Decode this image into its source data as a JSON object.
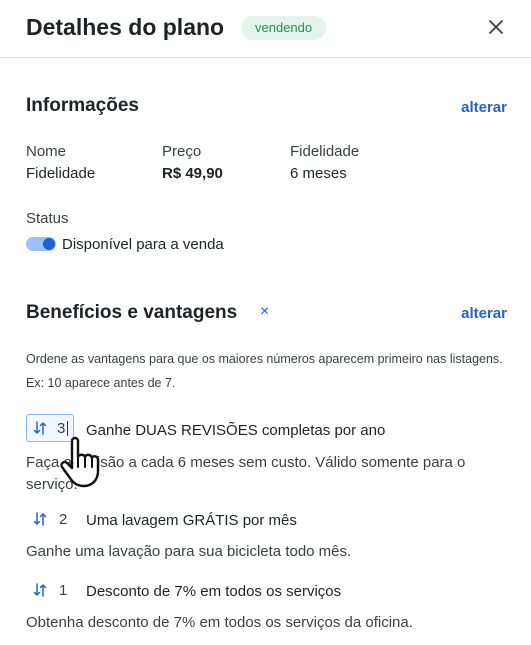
{
  "header": {
    "title": "Detalhes do plano",
    "status_badge": "vendendo"
  },
  "info": {
    "title": "Informações",
    "edit_link": "alterar",
    "fields": [
      {
        "label": "Nome",
        "value": "Fidelidade"
      },
      {
        "label": "Preço",
        "value": "R$ 49,90"
      },
      {
        "label": "Fidelidade",
        "value": "6 meses"
      }
    ],
    "status_label": "Status",
    "status_toggle_label": "Disponível para a venda",
    "status_on": true
  },
  "benefits": {
    "title": "Benefícios e vantagens",
    "close_glyph": "×",
    "edit_link": "alterar",
    "helper": "Ordene as vantagens para que os maiores números aparecem primeiro nas listagens. Ex: 10 aparece antes de 7.",
    "items": [
      {
        "order": "3",
        "title": "Ganhe DUAS REVISÕES completas por ano",
        "description": "Faça a revisão a cada 6 meses sem custo. Válido somente para o serviço."
      },
      {
        "order": "2",
        "title": "Uma lavagem GRÁTIS por mês",
        "description": "Ganhe uma lavação para sua bicicleta todo mês."
      },
      {
        "order": "1",
        "title": "Desconto de 7% em todos os serviços",
        "description": "Obtenha desconto de 7% em todos os serviços da oficina."
      }
    ]
  },
  "colors": {
    "accent": "#2563c9",
    "badge_bg": "#e3f4ea",
    "badge_text": "#2e8b57"
  },
  "icons": {
    "close": "close-icon",
    "sort": "sort-icon",
    "cursor": "hand-pointer-cursor"
  }
}
